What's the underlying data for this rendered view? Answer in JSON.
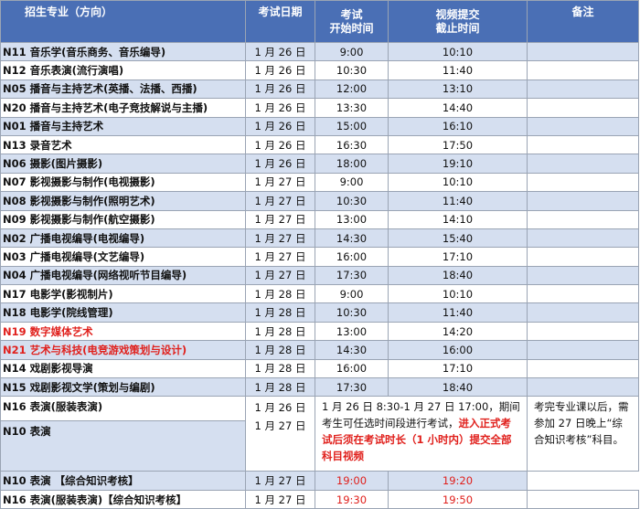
{
  "headers": {
    "major": "招生专业（方向）",
    "date": "考试日期",
    "start": "考试\n开始时间",
    "start_line1": "考试",
    "start_line2": "开始时间",
    "end_line1": "视频提交",
    "end_line2": "截止时间",
    "notes": "备注"
  },
  "rows": [
    {
      "major": "N11 音乐学(音乐商务、音乐编导)",
      "date": "1 月 26 日",
      "start": "9:00",
      "end": "10:10"
    },
    {
      "major": "N12 音乐表演(流行演唱)",
      "date": "1 月 26 日",
      "start": "10:30",
      "end": "11:40"
    },
    {
      "major": "N05 播音与主持艺术(英播、法播、西播)",
      "date": "1 月 26 日",
      "start": "12:00",
      "end": "13:10"
    },
    {
      "major": "N20 播音与主持艺术(电子竞技解说与主播)",
      "date": "1 月 26 日",
      "start": "13:30",
      "end": "14:40"
    },
    {
      "major": "N01 播音与主持艺术",
      "date": "1 月 26 日",
      "start": "15:00",
      "end": "16:10"
    },
    {
      "major": "N13 录音艺术",
      "date": "1 月 26 日",
      "start": "16:30",
      "end": "17:50"
    },
    {
      "major": "N06 摄影(图片摄影)",
      "date": "1 月 26 日",
      "start": "18:00",
      "end": "19:10"
    },
    {
      "major": "N07 影视摄影与制作(电视摄影)",
      "date": "1 月 27 日",
      "start": "9:00",
      "end": "10:10"
    },
    {
      "major": "N08 影视摄影与制作(照明艺术)",
      "date": "1 月 27 日",
      "start": "10:30",
      "end": "11:40"
    },
    {
      "major": "N09 影视摄影与制作(航空摄影)",
      "date": "1 月 27 日",
      "start": "13:00",
      "end": "14:10"
    },
    {
      "major": "N02 广播电视编导(电视编导)",
      "date": "1 月 27 日",
      "start": "14:30",
      "end": "15:40"
    },
    {
      "major": "N03 广播电视编导(文艺编导)",
      "date": "1 月 27 日",
      "start": "16:00",
      "end": "17:10"
    },
    {
      "major": "N04 广播电视编导(网络视听节目编导)",
      "date": "1 月 27 日",
      "start": "17:30",
      "end": "18:40"
    },
    {
      "major": "N17 电影学(影视制片)",
      "date": "1 月 28 日",
      "start": "9:00",
      "end": "10:10"
    },
    {
      "major": "N18 电影学(院线管理)",
      "date": "1 月 28 日",
      "start": "10:30",
      "end": "11:40"
    },
    {
      "major": "N19 数字媒体艺术",
      "date": "1 月 28 日",
      "start": "13:00",
      "end": "14:20",
      "highlight": true
    },
    {
      "major": "N21 艺术与科技(电竞游戏策划与设计)",
      "date": "1 月 28 日",
      "start": "14:30",
      "end": "16:00",
      "highlight": true
    },
    {
      "major": "N14 戏剧影视导演",
      "date": "1 月 28 日",
      "start": "16:00",
      "end": "17:10"
    },
    {
      "major": "N15 戏剧影视文学(策划与编剧)",
      "date": "1 月 28 日",
      "start": "17:30",
      "end": "18:40"
    }
  ],
  "special": {
    "major_a": "N16 表演(服装表演)",
    "major_b": "N10 表演",
    "date_a": "1 月 26 日",
    "date_b": "1 月 27 日",
    "window_text_1": "1 月 26 日 8:30-1 月 27 日 17:00，期间考生可任选时间段进行考试，",
    "window_text_emph": "进入正式考试后须在考试时长（1 小时内）提交全部科目视频",
    "note": "考完专业课以后，需参加 27 日晚上“综合知识考核”科目。"
  },
  "knowledge_rows": [
    {
      "major": "N10 表演 【综合知识考核】",
      "date": "1 月 27 日",
      "start": "19:00",
      "end": "19:20"
    },
    {
      "major": "N16 表演(服装表演)【综合知识考核】",
      "date": "1 月 27 日",
      "start": "19:30",
      "end": "19:50"
    }
  ],
  "colors": {
    "header_bg": "#4a6fb5",
    "row_alt": "#d5dff0",
    "highlight_text": "#e0201c"
  }
}
